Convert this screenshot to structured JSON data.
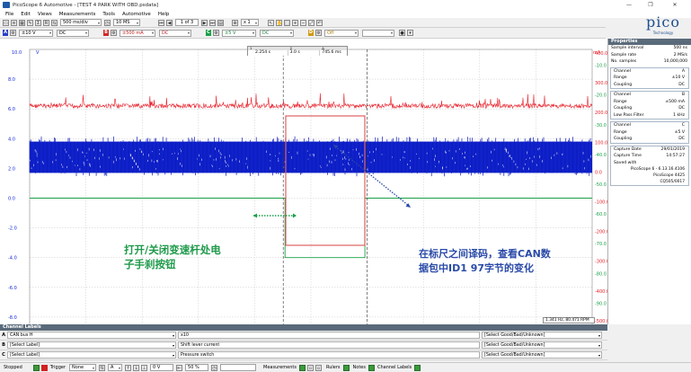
{
  "window": {
    "title": "PicoScope 6 Automotive - [TEST 4 PARK WITH OBD.psdata]",
    "minimize": "—",
    "maximize": "❐",
    "close": "✕"
  },
  "menu": [
    "File",
    "Edit",
    "Views",
    "Measurements",
    "Tools",
    "Automotive",
    "Help"
  ],
  "toolbar": {
    "timebase": "500 ms/div",
    "samples": "10 MS",
    "page": "1 of 3",
    "zoom": "x 1"
  },
  "channels_toolbar": {
    "a": {
      "letter": "A",
      "range": "±10 V",
      "coupling": "DC"
    },
    "b": {
      "letter": "B",
      "range": "±500 mA",
      "coupling": "DC"
    },
    "c": {
      "letter": "C",
      "range": "±5 V",
      "coupling": "DC"
    },
    "d": {
      "letter": "D",
      "range": "Off",
      "coupling": ""
    }
  },
  "logo": {
    "name": "pico",
    "sub": "Technology"
  },
  "ruler_box": {
    "c1": "1",
    "c2": "2",
    "c3": "Δ",
    "v1": "2.254 s",
    "v2": "3.0 s",
    "v3": "745.6 ms",
    "hz": "1.341 Hz, 80.471 RPM"
  },
  "axes": {
    "left_unit": "V",
    "left_top": "10.0",
    "left_ticks": [
      "8.0",
      "6.0",
      "4.0",
      "2.0",
      "0.0",
      "-2.0",
      "-4.0",
      "-6.0",
      "-8.0",
      "-10.0"
    ],
    "right_unit": "mA",
    "right_ticks": [
      "400.0",
      "300.0",
      "200.0",
      "100.0",
      "0.0",
      "-100.0",
      "-200.0",
      "-300.0",
      "-400.0",
      "-500.0"
    ],
    "right2_ticks": [
      "-10.0",
      "-20.0",
      "-30.0",
      "-40.0",
      "-50.0",
      "-60.0",
      "-70.0",
      "-80.0",
      "-90.0",
      "-100.0"
    ],
    "x_ticks": [
      "0.0",
      "0.5",
      "1.0",
      "1.5",
      "2.0",
      "2.5",
      "3.0",
      "3.5",
      "4.0",
      "4.5"
    ],
    "x_unit": "s"
  },
  "annotation_left": {
    "line1": "打开/关闭变速杆处电",
    "line2": "子手刹按钮"
  },
  "annotation_right": {
    "line1": "在标尺之间译码，查看CAN数",
    "line2": "据包中ID1 97字节的变化"
  },
  "properties": {
    "title": "Properties",
    "general": [
      [
        "Sample interval",
        "500 ns"
      ],
      [
        "Sample rate",
        "2 MS/s"
      ],
      [
        "No. samples",
        "10,000,000"
      ]
    ],
    "chA": [
      [
        "Channel",
        "A"
      ],
      [
        "Range",
        "±10 V"
      ],
      [
        "Coupling",
        "DC"
      ]
    ],
    "chB": [
      [
        "Channel",
        "B"
      ],
      [
        "Range",
        "±500 mA"
      ],
      [
        "Coupling",
        "DC"
      ],
      [
        "Low Pass Filter",
        "1 kHz"
      ]
    ],
    "chC": [
      [
        "Channel",
        "C"
      ],
      [
        "Range",
        "±5 V"
      ],
      [
        "Coupling",
        "DC"
      ]
    ],
    "capture": [
      [
        "Capture Date",
        "29/01/2019"
      ],
      [
        "Capture Time",
        "14:57:27"
      ],
      [
        "Saved with",
        ""
      ]
    ],
    "saved": [
      "PicoScope 6 - 6.13.16.4106",
      "PicoScope 4425",
      "CQ505/0017"
    ]
  },
  "channel_labels": {
    "title": "Channel Labels",
    "rows": [
      {
        "ch": "A",
        "label": "CAN bus H",
        "desc": "x10",
        "status": "[Select Good/Bad/Unknown]"
      },
      {
        "ch": "B",
        "label": "[Select Label]",
        "desc": "Shift lever current",
        "status": "[Select Good/Bad/Unknown]"
      },
      {
        "ch": "C",
        "label": "[Select Label]",
        "desc": "Pressure switch",
        "status": "[Select Good/Bad/Unknown]"
      }
    ]
  },
  "statusbar": {
    "state": "Stopped",
    "trigger": "Trigger",
    "trigger_val": "None",
    "ch": "A",
    "level": "0 V",
    "pre": "50 %",
    "measurements": "Measurements",
    "rulers": "Rulers",
    "notes": "Notes",
    "channel_labels": "Channel Labels"
  },
  "colors": {
    "red": "#e8202a",
    "blue": "#1428d8",
    "green": "#18a048"
  }
}
